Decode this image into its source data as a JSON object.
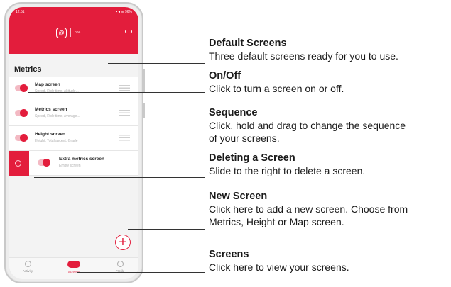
{
  "phone": {
    "status": {
      "time": "12:51",
      "icons": "▪ ◂ ≋ 96%"
    },
    "brand": {
      "logo": "@",
      "name": "one"
    },
    "section_title": "Metrics",
    "screens": [
      {
        "title": "Map screen",
        "subtitle": "Speed, Ride time, Altitude...",
        "enabled": true
      },
      {
        "title": "Metrics screen",
        "subtitle": "Speed, Ride time, Average...",
        "enabled": true
      },
      {
        "title": "Height screen",
        "subtitle": "Height, Total ascent, Grade",
        "enabled": true
      },
      {
        "title": "Extra metrics screen",
        "subtitle": "Empty screen",
        "enabled": true,
        "swiped": true
      }
    ],
    "add_button": "+",
    "nav": [
      {
        "label": "Activity",
        "active": false
      },
      {
        "label": "Screens",
        "active": true
      },
      {
        "label": "Profile",
        "active": false
      }
    ],
    "accent_color": "#e31d3c"
  },
  "annotations": [
    {
      "title": "Default Screens",
      "lines": [
        "Three default screens ready for you to use."
      ]
    },
    {
      "title": "On/Off",
      "lines": [
        "Click to turn a screen on or off."
      ]
    },
    {
      "title": "Sequence",
      "lines": [
        "Click, hold and drag to change the sequence",
        "of your screens."
      ]
    },
    {
      "title": "Deleting a Screen",
      "lines": [
        "Slide to the right to delete a screen."
      ]
    },
    {
      "title": "New Screen",
      "lines": [
        "Click here to add a new screen. Choose from",
        "Metrics, Height or Map screen."
      ]
    },
    {
      "title": "Screens",
      "lines": [
        "Click here to view your screens."
      ]
    }
  ]
}
